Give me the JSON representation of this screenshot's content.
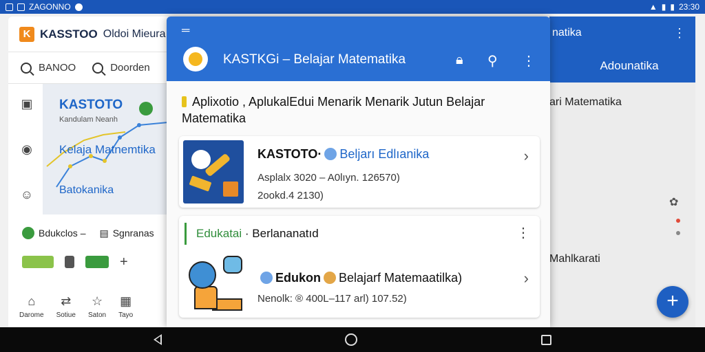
{
  "statusbar": {
    "left_text": "ZAGONNO",
    "right_text": "23:30"
  },
  "left_app": {
    "brand": "KASSTOO",
    "brand_suffix": "Oldoi Mieura",
    "search_label": "BANOO",
    "search_label_2": "Doorden",
    "hero_title": "KASTOTO",
    "hero_subtitle": "Kandulam Neanh",
    "hero_line2": "Kelaja Matnemtika",
    "hero_line3": "Batokanika",
    "row_item_1": "Bdukclos –",
    "row_item_2": "Sgnranas",
    "bottom_items": [
      "Darome",
      "Sotiue",
      "Saton",
      "Tayo"
    ]
  },
  "main": {
    "title": "KASTKGi – Belajar Matematika",
    "intro": "Aplixotio , AplukalEdui Menarik Menarik Jutun Belajar Matematika",
    "card1": {
      "title_bold": "KASTOTO·",
      "title_accent": "Beljarı Edlıanika",
      "line1": "Asplalx 3020 – A0lıyn. 126570)",
      "line2": "2ookd.4 2130)"
    },
    "card2": {
      "section_accent": "Edukatai",
      "section_rest": "· Berlananatıd",
      "title_bold": "Edukon",
      "title_rest": "Belajarf Matemaatilka)",
      "line1": "Nenolk: ® 400L–117 arl) 107.52)"
    }
  },
  "right_app": {
    "top_text": "natika",
    "tab_label": "Adounatika",
    "text_1": "ari Matematika",
    "text_2": "Mahlkarati"
  },
  "colors": {
    "primary": "#2a6fd3",
    "accent_green": "#3a9b3e",
    "accent_orange": "#f08a1c"
  }
}
